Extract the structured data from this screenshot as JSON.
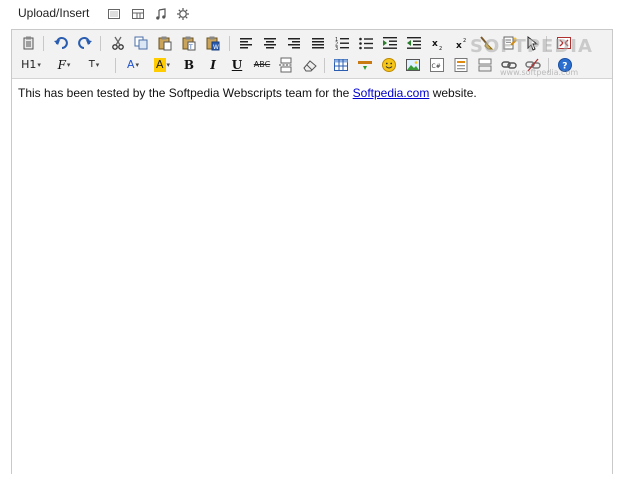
{
  "upload_bar": {
    "label": "Upload/Insert",
    "icons": [
      "add-image-icon",
      "add-video-icon",
      "add-audio-icon",
      "add-media-icon"
    ]
  },
  "toolbar": {
    "row1": [
      "paste-icon",
      "undo-icon",
      "redo-icon",
      "cut-icon",
      "copy-icon",
      "paste-text-icon",
      "paste-word-icon",
      "paste-office-icon",
      "align-left-icon",
      "align-center-icon",
      "align-right-icon",
      "align-justify-icon",
      "numbered-list-icon",
      "bullet-list-icon",
      "indent-icon",
      "outdent-icon",
      "subscript-icon",
      "superscript-icon",
      "format-painter-icon",
      "find-replace-icon",
      "select-all-icon",
      "fullscreen-icon"
    ],
    "row2": {
      "heading_label": "H1",
      "font_label": "F",
      "size_label": "T",
      "font_color_label": "A",
      "highlight_label": "A",
      "bold_label": "B",
      "italic_label": "I",
      "underline_label": "U",
      "strike_label": "ABC",
      "highlight_color": "#ffcc00",
      "font_color": "#2255cc"
    }
  },
  "content": {
    "text_before": "This has been tested by the Softpedia Webscripts team for the ",
    "link_text": "Softpedia.com",
    "text_after": " website."
  },
  "watermark": {
    "text": "SOFTPEDIA",
    "url": "www.softpedia.com"
  }
}
